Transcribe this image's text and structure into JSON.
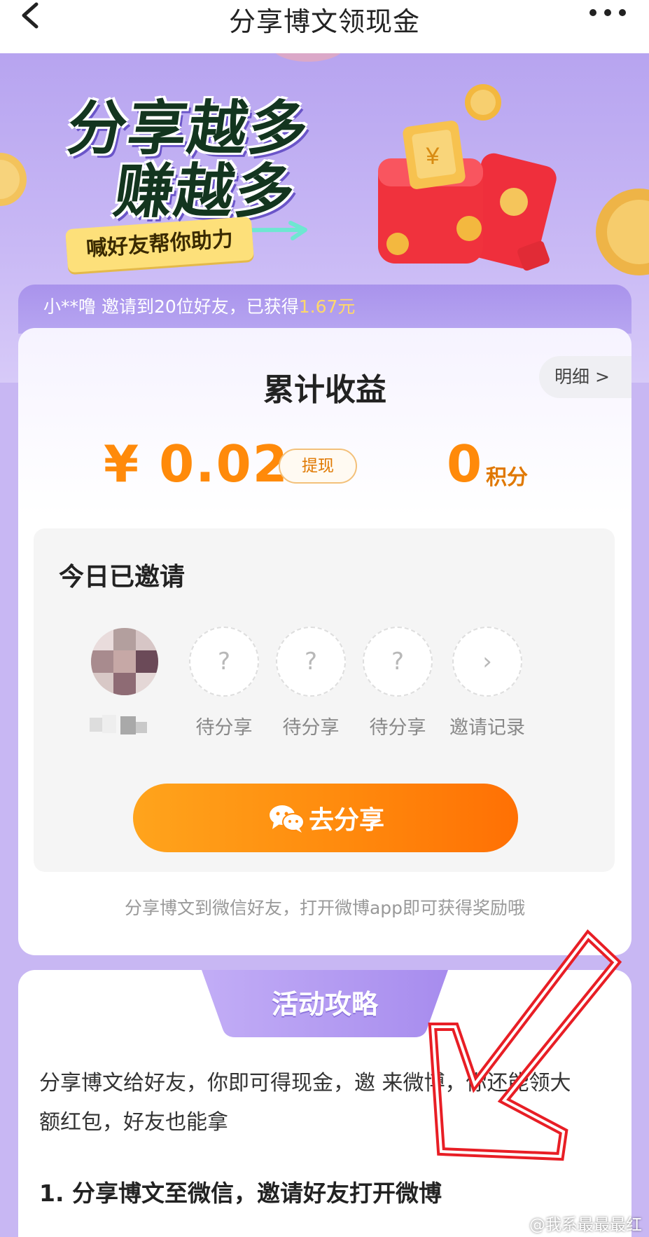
{
  "nav": {
    "title": "分享博文领现金"
  },
  "banner": {
    "slogan_line1": "分享越多",
    "slogan_line2": "赚越多",
    "tag": "喊好友帮你助力"
  },
  "ticker": {
    "prefix": "小**噜 邀请到20位好友，已获得",
    "amount": "1.67元"
  },
  "earnings": {
    "title": "累计收益",
    "detail_label": "明细 >",
    "amount": "¥ 0.02",
    "withdraw_label": "提现",
    "points_value": "0",
    "points_unit": "积分"
  },
  "invite": {
    "title": "今日已邀请",
    "slots": [
      {
        "symbol": "?",
        "label": "待分享"
      },
      {
        "symbol": "?",
        "label": "待分享"
      },
      {
        "symbol": "?",
        "label": "待分享"
      },
      {
        "symbol": "›",
        "label": "邀请记录"
      }
    ],
    "share_button": "去分享",
    "hint": "分享博文到微信好友，打开微博app即可获得奖励哦"
  },
  "strategy": {
    "tab": "活动攻略",
    "paragraph": "分享博文给好友，你即可得现金，邀        来微博，你还能领大额红包，好友也能拿",
    "step1": "1. 分享博文至微信，邀请好友打开微博"
  },
  "watermark": "@我系最最最红",
  "colors": {
    "accent_orange": "#ff8a0a",
    "purple": "#b7a4f0",
    "annotation_red": "#e81e25"
  }
}
